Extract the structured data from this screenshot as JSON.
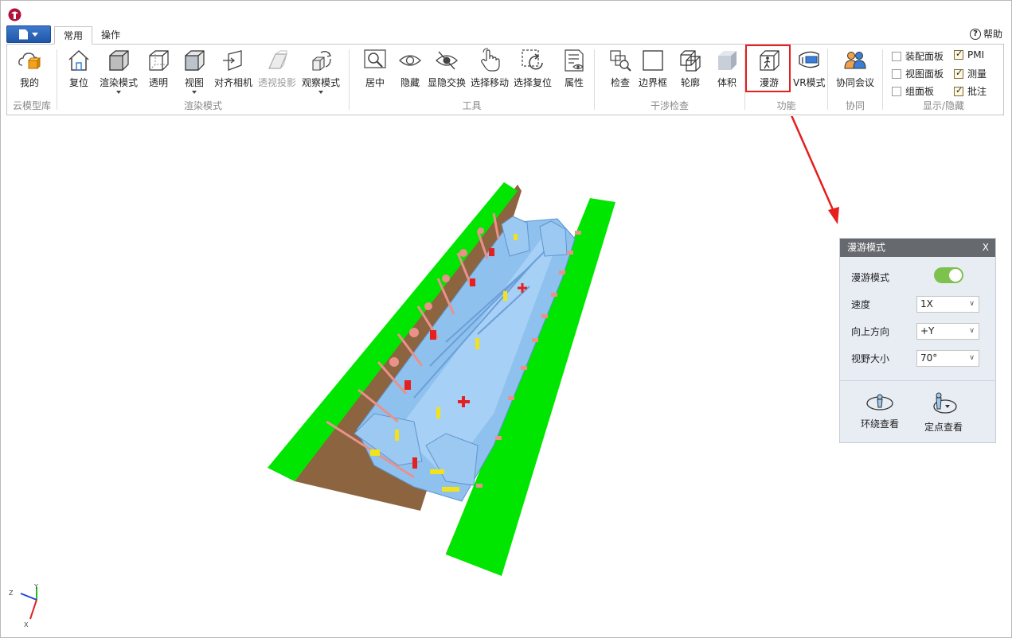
{
  "tabs": [
    {
      "label": "常用",
      "active": true
    },
    {
      "label": "操作",
      "active": false
    }
  ],
  "help": {
    "label": "帮助"
  },
  "groups": {
    "cloud": {
      "label": "云模型库",
      "buttons": [
        {
          "label": "我的",
          "icon": "cloud-box-icon"
        }
      ]
    },
    "render": {
      "label": "渲染模式",
      "buttons": [
        {
          "label": "复位",
          "icon": "home-icon"
        },
        {
          "label": "渲染模式",
          "icon": "cube-solid-icon",
          "dropdown": true
        },
        {
          "label": "透明",
          "icon": "cube-transparent-icon"
        },
        {
          "label": "视图",
          "icon": "cube-view-icon",
          "dropdown": true
        },
        {
          "label": "对齐相机",
          "icon": "align-camera-icon"
        },
        {
          "label": "透视投影",
          "icon": "perspective-icon",
          "disabled": true
        },
        {
          "label": "观察模式",
          "icon": "observe-mode-icon",
          "dropdown": true
        }
      ]
    },
    "tools": {
      "label": "工具",
      "buttons": [
        {
          "label": "居中",
          "icon": "zoom-center-icon"
        },
        {
          "label": "隐藏",
          "icon": "eye-icon"
        },
        {
          "label": "显隐交换",
          "icon": "eye-slash-icon"
        },
        {
          "label": "选择移动",
          "icon": "hand-pointer-icon"
        },
        {
          "label": "选择复位",
          "icon": "select-reset-icon"
        },
        {
          "label": "属性",
          "icon": "properties-icon"
        }
      ]
    },
    "interference": {
      "label": "干涉检查",
      "buttons": [
        {
          "label": "检查",
          "icon": "check-search-icon"
        },
        {
          "label": "边界框",
          "icon": "bounding-box-icon"
        },
        {
          "label": "轮廓",
          "icon": "outline-icon"
        },
        {
          "label": "体积",
          "icon": "volume-icon"
        }
      ]
    },
    "function": {
      "label": "功能",
      "buttons": [
        {
          "label": "漫游",
          "icon": "walk-cube-icon"
        },
        {
          "label": "VR模式",
          "icon": "vr-headset-icon"
        }
      ]
    },
    "collab": {
      "label": "协同",
      "buttons": [
        {
          "label": "协同会议",
          "icon": "users-icon"
        }
      ]
    },
    "display": {
      "label": "显示/隐藏",
      "checks": [
        {
          "label": "装配面板",
          "checked": false
        },
        {
          "label": "视图面板",
          "checked": false
        },
        {
          "label": "组面板",
          "checked": false
        },
        {
          "label": "PMI",
          "checked": true
        },
        {
          "label": "测量",
          "checked": true
        },
        {
          "label": "批注",
          "checked": true
        }
      ]
    }
  },
  "panel": {
    "title": "漫游模式",
    "close": "X",
    "toggle_label": "漫游模式",
    "toggle_on": true,
    "speed_label": "速度",
    "speed_value": "1X",
    "up_label": "向上方向",
    "up_value": "+Y",
    "fov_label": "视野大小",
    "fov_value": "70°",
    "orbit_label": "环绕查看",
    "fixed_label": "定点查看"
  },
  "axis": {
    "y": "Y",
    "z": "Z",
    "x": "X"
  },
  "colors": {
    "accent": "#1f56a8",
    "highlight": "#e51e1e",
    "toggle": "#7cc24d",
    "ground_green": "#00e600",
    "soil": "#8c6440",
    "model_blue": "#8fc1ee"
  }
}
